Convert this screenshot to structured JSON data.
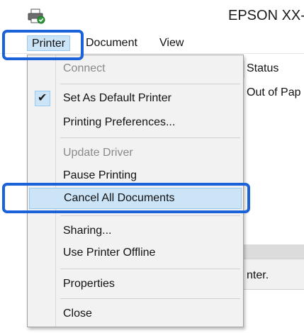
{
  "window": {
    "title": "EPSON XX-"
  },
  "menubar": {
    "items": [
      {
        "label": "Printer"
      },
      {
        "label": "Document"
      },
      {
        "label": "View"
      }
    ]
  },
  "list": {
    "columns": [
      {
        "label": "Status"
      }
    ],
    "rows": [
      {
        "status": "Out of Pap"
      }
    ]
  },
  "statusbar": {
    "text": "nter."
  },
  "printer_menu": {
    "items": [
      {
        "label": "Connect",
        "enabled": false
      },
      {
        "label": "Set As Default Printer",
        "checked": true
      },
      {
        "label": "Printing Preferences..."
      },
      {
        "label": "Update Driver",
        "enabled": false
      },
      {
        "label": "Pause Printing"
      },
      {
        "label": "Cancel All Documents",
        "highlighted": true
      },
      {
        "label": "Sharing..."
      },
      {
        "label": "Use Printer Offline"
      },
      {
        "label": "Properties"
      },
      {
        "label": "Close"
      }
    ],
    "check_glyph": "✔"
  },
  "colors": {
    "callout_border": "#1a62d8",
    "menu_highlight": "#cce4f7",
    "menu_background": "#f2f2f2"
  },
  "icons": {
    "app": "printer-icon"
  }
}
